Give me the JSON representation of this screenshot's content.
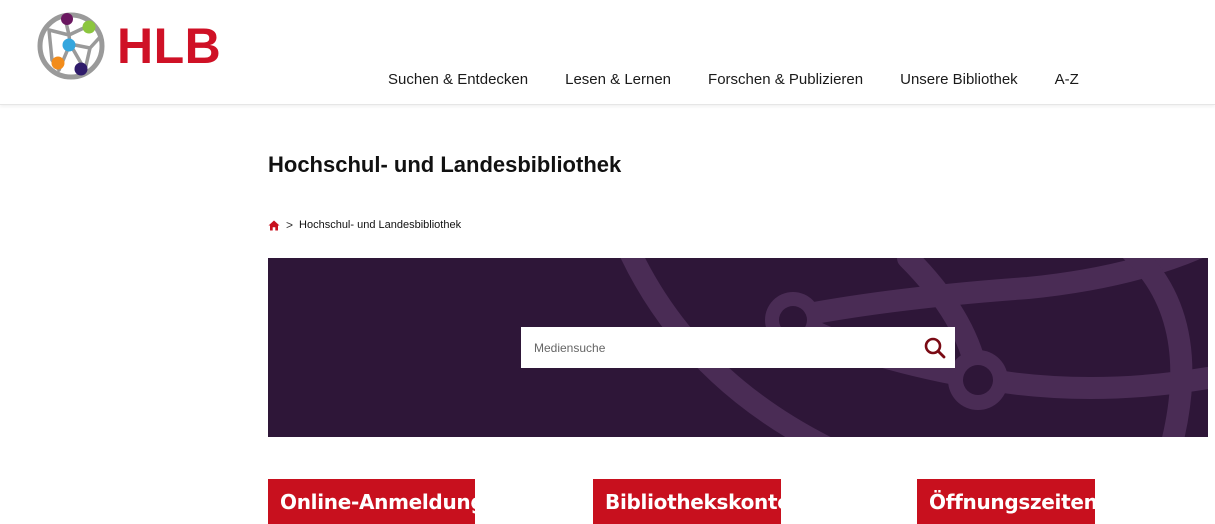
{
  "logo": {
    "text": "HLB",
    "icon": "network-circle-logo-icon"
  },
  "nav": {
    "items": [
      {
        "label": "Suchen & Entdecken"
      },
      {
        "label": "Lesen & Lernen"
      },
      {
        "label": "Forschen & Publizieren"
      },
      {
        "label": "Unsere Bibliothek"
      },
      {
        "label": "A-Z"
      }
    ]
  },
  "page": {
    "title": "Hochschul- und Landesbibliothek"
  },
  "breadcrumb": {
    "home_icon": "home-icon",
    "separator": ">",
    "current": "Hochschul- und Landesbibliothek"
  },
  "search": {
    "placeholder": "Mediensuche",
    "icon": "search-icon"
  },
  "quick_links": [
    {
      "label": "Online-Anmeldung"
    },
    {
      "label": "Bibliothekskonto"
    },
    {
      "label": "Öffnungszeiten"
    }
  ],
  "colors": {
    "brand_red": "#cf1126",
    "button_red": "#c8101e",
    "hero_purple": "#2e1638",
    "search_icon": "#7a0a14"
  }
}
